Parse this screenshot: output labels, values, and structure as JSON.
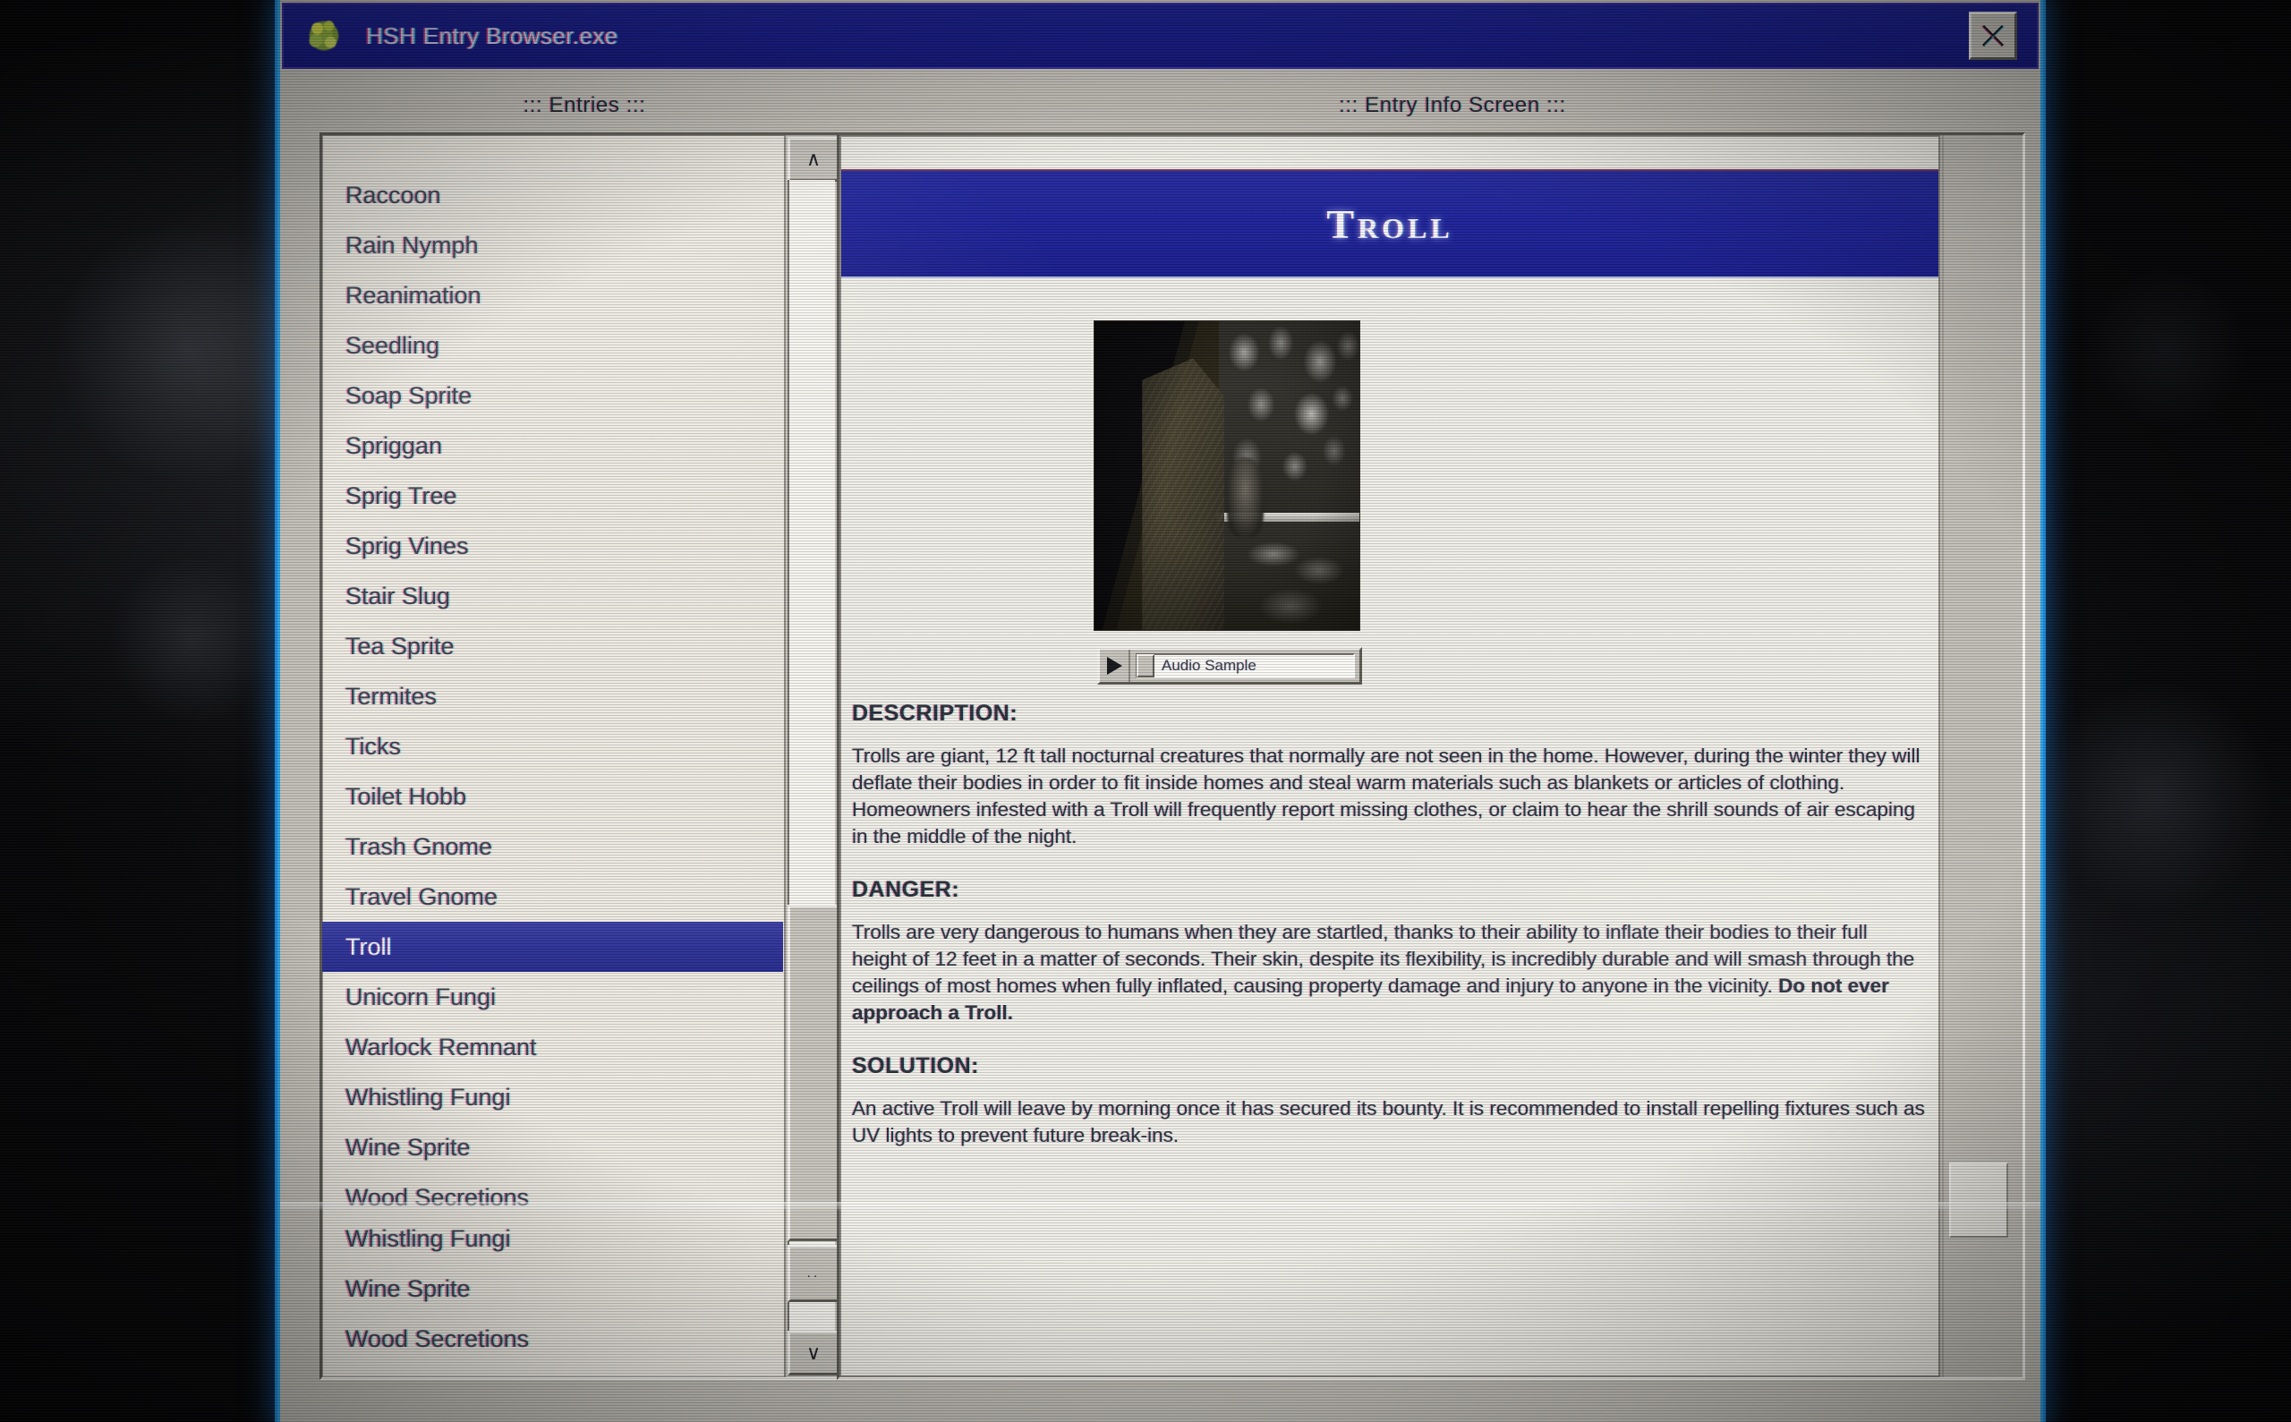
{
  "window": {
    "title": "HSH Entry Browser.exe",
    "icon": "brain-orb-icon",
    "close_label": "✕"
  },
  "panels": {
    "entries_caption": "::: Entries :::",
    "info_caption": "::: Entry Info Screen :::"
  },
  "entries": {
    "items": [
      "Raccoon",
      "Rain Nymph",
      "Reanimation",
      "Seedling",
      "Soap Sprite",
      "Spriggan",
      "Sprig Tree",
      "Sprig Vines",
      "Stair Slug",
      "Tea Sprite",
      "Termites",
      "Ticks",
      "Toilet Hobb",
      "Trash Gnome",
      "Travel Gnome",
      "Troll",
      "Unicorn Fungi",
      "Warlock Remnant",
      "Whistling Fungi",
      "Wine Sprite",
      "Wood Secretions"
    ],
    "selected": "Troll",
    "selected_index": 15,
    "ghost_items": [
      "Whistling Fungi",
      "Wine Sprite",
      "Wood Secretions"
    ],
    "scroll_up_glyph": "∧",
    "scroll_down_glyph": "∨",
    "scroll_thumb2_glyph": ".."
  },
  "entry": {
    "title": "Troll",
    "photo_alt": "grainy photo of a curtained window with a shadowed figure",
    "audio": {
      "label": "Audio Sample",
      "play_glyph": "▶"
    },
    "sections": [
      {
        "heading": "DESCRIPTION:",
        "body": "Trolls are giant, 12 ft tall nocturnal creatures that normally are not seen in the home. However, during the winter they will deflate their bodies in order to fit inside homes and steal warm materials such as blankets or articles of clothing. Homeowners infested with a Troll will frequently report missing clothes, or claim to hear the shrill sounds of air escaping in the middle of the night.",
        "bold_tail": ""
      },
      {
        "heading": "DANGER:",
        "body": "Trolls are very dangerous to humans when they are startled, thanks to their ability to inflate their bodies to their full height of 12 feet in a matter of seconds. Their skin, despite its flexibility, is incredibly durable and will smash through the ceilings of most homes when fully inflated, causing property damage and injury to anyone in the vicinity. ",
        "bold_tail": "Do not ever approach a Troll."
      },
      {
        "heading": "SOLUTION:",
        "body": "An active Troll will leave by morning once it has secured its bounty. It is recommended to install repelling fixtures such as UV lights to prevent future break-ins.",
        "bold_tail": ""
      }
    ]
  },
  "colors": {
    "titlebar_blue": "#181c86",
    "accent_blue": "#1d229a",
    "selection_blue": "#2e3398",
    "window_chrome": "#c2bfb8",
    "panel_paper": "#f0eee7",
    "border_glow_cyan": "#2aa5e8",
    "body_text": "#2b313c"
  }
}
